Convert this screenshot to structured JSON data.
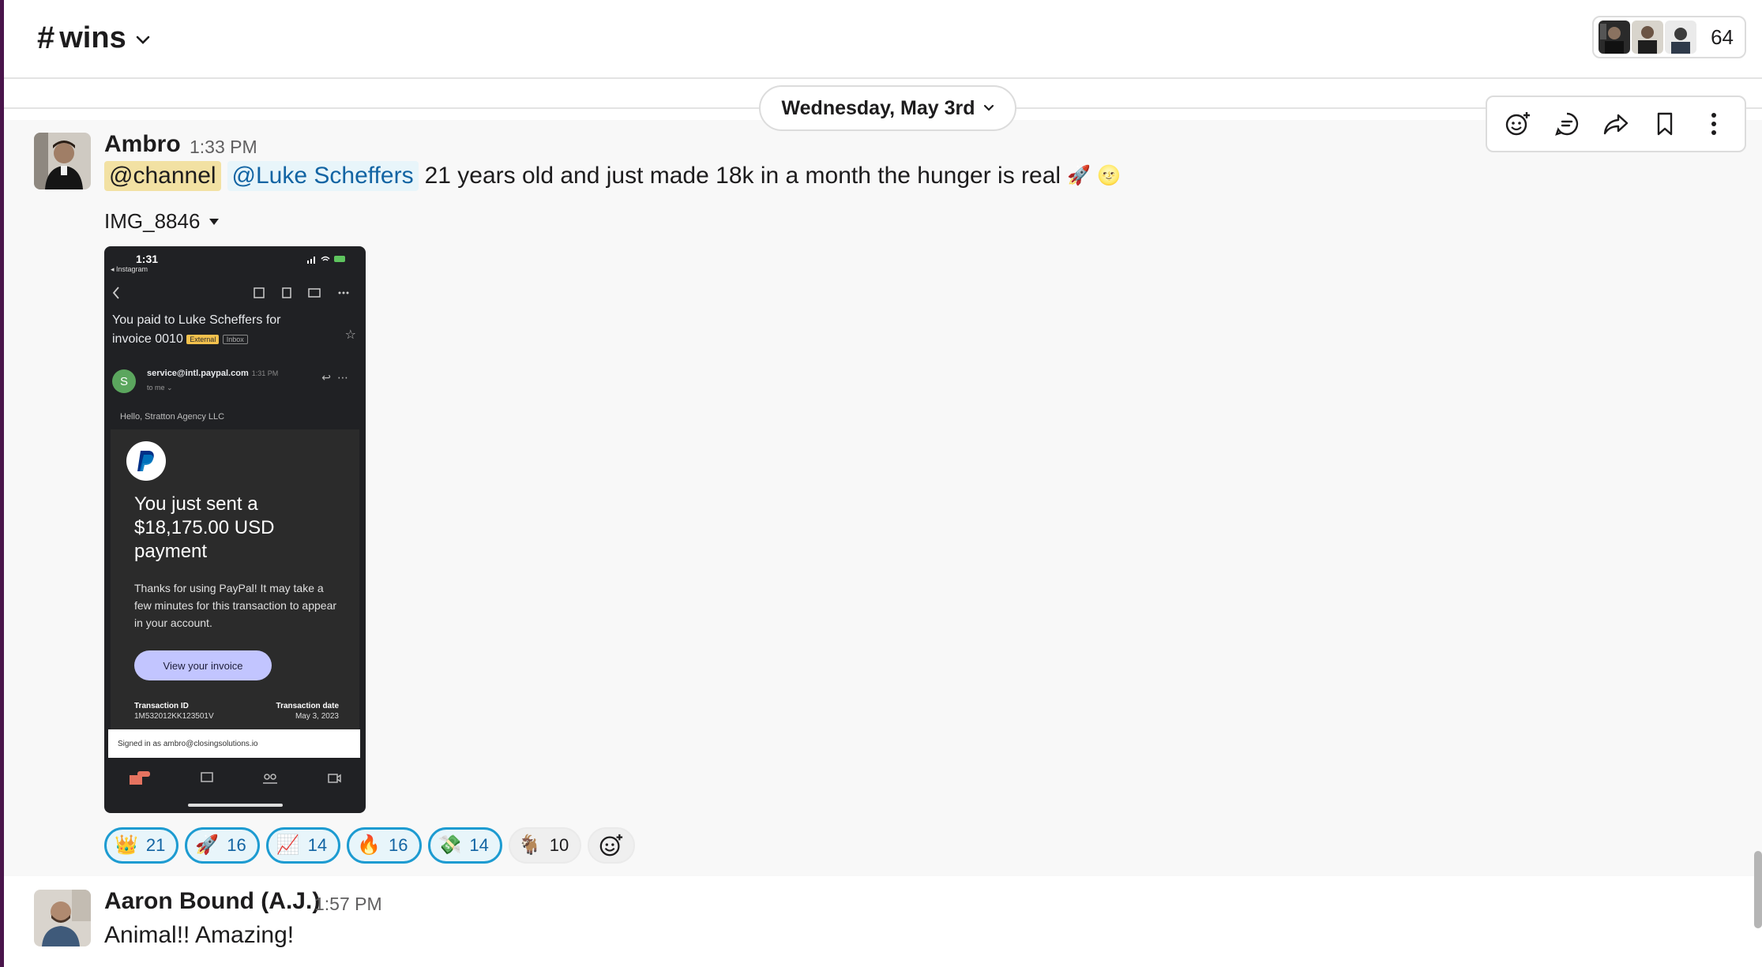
{
  "channel": {
    "hash": "#",
    "name": "wins",
    "member_count": "64"
  },
  "date_divider": "Wednesday, May 3rd",
  "toolbar": {
    "icons": [
      "add-reaction-icon",
      "reply-in-thread-icon",
      "share-icon",
      "save-icon",
      "more-actions-icon"
    ]
  },
  "messages": [
    {
      "author": "Ambro",
      "time": "1:33 PM",
      "mention_channel": "@channel",
      "mention_user": "@Luke Scheffers",
      "text": "21 years old and just made 18k in a month the hunger is real",
      "emojis": [
        "🚀",
        "🌝"
      ],
      "attachment": {
        "name": "IMG_8846",
        "screenshot": {
          "status_time": "1:31",
          "back_app": "◂ Instagram",
          "subject": "You paid to Luke Scheffers for invoice 0010",
          "tag_external": "External",
          "tag_inbox": "Inbox",
          "sender_initial": "S",
          "sender": "service@intl.paypal.com",
          "sender_time": "1:31 PM",
          "to_me": "to me ⌄",
          "greeting": "Hello, Stratton Agency LLC",
          "headline": "You just sent a $18,175.00 USD payment",
          "body": "Thanks for using PayPal! It may take a few minutes for this transaction to appear in your account.",
          "button": "View your invoice",
          "tx_id_label": "Transaction ID",
          "tx_id": "1M532012KK123501V",
          "tx_date_label": "Transaction date",
          "tx_date": "May 3, 2023",
          "signed_in": "Signed in as ambro@closingsolutions.io"
        }
      },
      "reactions": [
        {
          "emoji": "👑",
          "count": "21",
          "reacted": true
        },
        {
          "emoji": "🚀",
          "count": "16",
          "reacted": true
        },
        {
          "emoji": "📈",
          "count": "14",
          "reacted": true
        },
        {
          "emoji": "🔥",
          "count": "16",
          "reacted": true
        },
        {
          "emoji": "💸",
          "count": "14",
          "reacted": true
        },
        {
          "emoji": "🐐",
          "count": "10",
          "reacted": false
        }
      ]
    },
    {
      "author": "Aaron Bound (A.J.)",
      "time": "1:57 PM",
      "text": "Animal!! Amazing!"
    }
  ],
  "colors": {
    "accent": "#1264a3",
    "rail": "#4a154b",
    "channel_mention_bg": "#f2e1a3"
  }
}
